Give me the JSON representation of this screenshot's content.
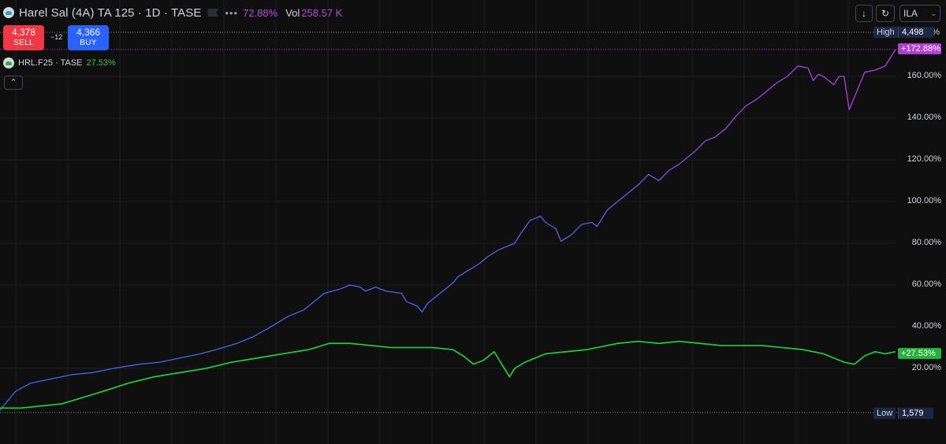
{
  "header": {
    "symbol_title": "Harel Sal (4A) TA 125 · 1D · TASE",
    "change_percent": "72.88%",
    "volume_label": "Vol",
    "volume_value": "258.57 K",
    "more_glyph": "•••",
    "flag_icon": "flag-icon",
    "more_icon": "more-icon"
  },
  "trade": {
    "sell_price": "4,378",
    "sell_label": "SELL",
    "spread": "−12",
    "buy_price": "4,366",
    "buy_label": "BUY"
  },
  "compare": {
    "symbol": "HRL.F25 · TASE",
    "change": "27.53%"
  },
  "toolbar": {
    "download_glyph": "↓",
    "reset_glyph": "↻",
    "currency": "ILA",
    "chevron": "⌄"
  },
  "collapse_glyph": "⌃",
  "price_scale": {
    "high_label": "High",
    "high_value": "4,498",
    "low_label": "Low",
    "low_value": "1,579",
    "main_last": "+172.88%",
    "compare_last": "+27.53%",
    "top_partial": "%"
  },
  "colors": {
    "background": "#0f0f0f",
    "main_line_start": "#3f6be8",
    "main_line_end": "#b83be0",
    "compare_line": "#22c43a",
    "sell": "#f23645",
    "buy": "#2962ff",
    "change_text": "#b44fd8"
  },
  "chart_data": {
    "type": "line",
    "ylabel": "",
    "xlabel": "",
    "y_unit": "%",
    "y_ticks": [
      20,
      40,
      60,
      80,
      100,
      120,
      140,
      160
    ],
    "y_tick_labels": [
      "20.00%",
      "40.00%",
      "60.00%",
      "80.00%",
      "100.00%",
      "120.00%",
      "140.00%",
      "160.00%"
    ],
    "ylim": [
      -1,
      176
    ],
    "series": [
      {
        "name": "Harel Sal (4A) TA 125",
        "last": 172.88,
        "points": [
          [
            0,
            0
          ],
          [
            3,
            9
          ],
          [
            6,
            13
          ],
          [
            10,
            15
          ],
          [
            14,
            17
          ],
          [
            18,
            18
          ],
          [
            22,
            20
          ],
          [
            27,
            22
          ],
          [
            31,
            23
          ],
          [
            35,
            25
          ],
          [
            39,
            27
          ],
          [
            42,
            29
          ],
          [
            46,
            32
          ],
          [
            49,
            35
          ],
          [
            52,
            39
          ],
          [
            54,
            42
          ],
          [
            56,
            45
          ],
          [
            59,
            48
          ],
          [
            61,
            52
          ],
          [
            63,
            56
          ],
          [
            66,
            58
          ],
          [
            68,
            60
          ],
          [
            70,
            59
          ],
          [
            71,
            57
          ],
          [
            73,
            59
          ],
          [
            75,
            57
          ],
          [
            78,
            56
          ],
          [
            79,
            52
          ],
          [
            81,
            50
          ],
          [
            82,
            47
          ],
          [
            83,
            51
          ],
          [
            86,
            57
          ],
          [
            88,
            61
          ],
          [
            89,
            64
          ],
          [
            91,
            67
          ],
          [
            93,
            70
          ],
          [
            95,
            74
          ],
          [
            97,
            77
          ],
          [
            100,
            80
          ],
          [
            101,
            84
          ],
          [
            103,
            91
          ],
          [
            105,
            93
          ],
          [
            106,
            90
          ],
          [
            108,
            87
          ],
          [
            109,
            81
          ],
          [
            111,
            84
          ],
          [
            113,
            89
          ],
          [
            115,
            90
          ],
          [
            116,
            88
          ],
          [
            118,
            96
          ],
          [
            120,
            100
          ],
          [
            122,
            104
          ],
          [
            124,
            108
          ],
          [
            126,
            113
          ],
          [
            128,
            110
          ],
          [
            130,
            115
          ],
          [
            132,
            118
          ],
          [
            133,
            120
          ],
          [
            135,
            124
          ],
          [
            137,
            129
          ],
          [
            139,
            131
          ],
          [
            141,
            135
          ],
          [
            143,
            141
          ],
          [
            145,
            146
          ],
          [
            147,
            149
          ],
          [
            149,
            153
          ],
          [
            151,
            157
          ],
          [
            153,
            160
          ],
          [
            155,
            165
          ],
          [
            157,
            164
          ],
          [
            158,
            158
          ],
          [
            159,
            161
          ],
          [
            160,
            160
          ],
          [
            161,
            158
          ],
          [
            162,
            156
          ],
          [
            163,
            160
          ],
          [
            164,
            160
          ],
          [
            165,
            144
          ],
          [
            166,
            150
          ],
          [
            168,
            162
          ],
          [
            170,
            163
          ],
          [
            172,
            165
          ],
          [
            174,
            172.88
          ]
        ]
      },
      {
        "name": "HRL.F25",
        "last": 27.53,
        "points": [
          [
            0,
            1
          ],
          [
            4,
            1
          ],
          [
            8,
            2
          ],
          [
            12,
            3
          ],
          [
            16,
            6
          ],
          [
            20,
            9
          ],
          [
            25,
            13
          ],
          [
            30,
            16
          ],
          [
            35,
            18
          ],
          [
            40,
            20
          ],
          [
            45,
            23
          ],
          [
            50,
            25
          ],
          [
            55,
            27
          ],
          [
            60,
            29
          ],
          [
            64,
            32
          ],
          [
            68,
            32
          ],
          [
            72,
            31
          ],
          [
            76,
            30
          ],
          [
            80,
            30
          ],
          [
            84,
            30
          ],
          [
            88,
            29
          ],
          [
            90,
            26
          ],
          [
            92,
            22
          ],
          [
            94,
            24
          ],
          [
            96,
            28
          ],
          [
            98,
            20
          ],
          [
            99,
            16
          ],
          [
            100,
            20
          ],
          [
            102,
            23
          ],
          [
            106,
            27
          ],
          [
            110,
            28
          ],
          [
            114,
            29
          ],
          [
            118,
            31
          ],
          [
            120,
            32
          ],
          [
            124,
            33
          ],
          [
            128,
            32
          ],
          [
            132,
            33
          ],
          [
            136,
            32
          ],
          [
            140,
            31
          ],
          [
            144,
            31
          ],
          [
            148,
            31
          ],
          [
            152,
            30
          ],
          [
            156,
            29
          ],
          [
            158,
            28
          ],
          [
            160,
            27
          ],
          [
            162,
            25
          ],
          [
            164,
            23
          ],
          [
            166,
            22
          ],
          [
            168,
            26
          ],
          [
            170,
            28
          ],
          [
            172,
            27
          ],
          [
            174,
            28
          ]
        ]
      }
    ],
    "x_range": [
      0,
      174
    ],
    "grid": true,
    "reference_lines": [
      "High",
      "Low",
      "Last"
    ]
  }
}
